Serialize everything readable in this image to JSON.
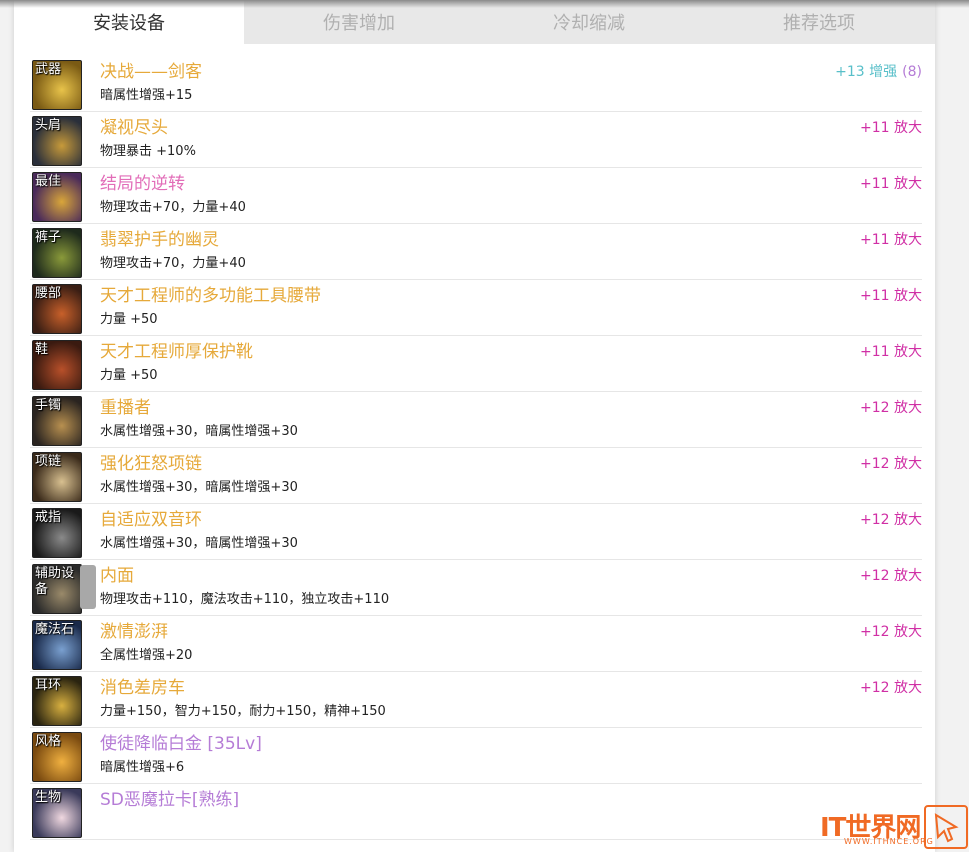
{
  "tabs": [
    {
      "label": "安装设备",
      "active": true
    },
    {
      "label": "伤害增加",
      "active": false
    },
    {
      "label": "冷却缩减",
      "active": false
    },
    {
      "label": "推荐选项",
      "active": false
    }
  ],
  "items": [
    {
      "slot": "武器",
      "name": "决战——剑客",
      "name_color": "gold",
      "stat": "暗属性增强+15",
      "upgrade": "+13 增强",
      "upgrade_count": "(8)",
      "upgrade_type": "enhance",
      "icon_colors": [
        "#7a5a14",
        "#e8c34a"
      ]
    },
    {
      "slot": "头肩",
      "name": "凝视尽头",
      "name_color": "gold",
      "stat": "物理暴击 +10%",
      "upgrade": "+11 放大",
      "upgrade_count": "",
      "upgrade_type": "amplify",
      "icon_colors": [
        "#2a2f3a",
        "#c79a3a"
      ]
    },
    {
      "slot": "最佳",
      "name": "结局的逆转",
      "name_color": "pink",
      "stat": "物理攻击+70，力量+40",
      "upgrade": "+11 放大",
      "upgrade_count": "",
      "upgrade_type": "amplify",
      "icon_colors": [
        "#4a2a5a",
        "#d9a63a"
      ]
    },
    {
      "slot": "裤子",
      "name": "翡翠护手的幽灵",
      "name_color": "gold",
      "stat": "物理攻击+70，力量+40",
      "upgrade": "+11 放大",
      "upgrade_count": "",
      "upgrade_type": "amplify",
      "icon_colors": [
        "#1e2a1c",
        "#8a9a3a"
      ]
    },
    {
      "slot": "腰部",
      "name": "天才工程师的多功能工具腰带",
      "name_color": "gold",
      "stat": "力量 +50",
      "upgrade": "+11 放大",
      "upgrade_count": "",
      "upgrade_type": "amplify",
      "icon_colors": [
        "#3a1e14",
        "#c8602a"
      ]
    },
    {
      "slot": "鞋",
      "name": "天才工程师厚保护靴",
      "name_color": "gold",
      "stat": "力量 +50",
      "upgrade": "+11 放大",
      "upgrade_count": "",
      "upgrade_type": "amplify",
      "icon_colors": [
        "#3a1a10",
        "#b8502a"
      ]
    },
    {
      "slot": "手镯",
      "name": "重播者",
      "name_color": "gold",
      "stat": "水属性增强+30，暗属性增强+30",
      "upgrade": "+12 放大",
      "upgrade_count": "",
      "upgrade_type": "amplify",
      "icon_colors": [
        "#2a2420",
        "#b89050"
      ]
    },
    {
      "slot": "项链",
      "name": "强化狂怒项链",
      "name_color": "gold",
      "stat": "水属性增强+30，暗属性增强+30",
      "upgrade": "+12 放大",
      "upgrade_count": "",
      "upgrade_type": "amplify",
      "icon_colors": [
        "#3a2a1a",
        "#d8c090"
      ]
    },
    {
      "slot": "戒指",
      "name": "自适应双音环",
      "name_color": "gold",
      "stat": "水属性增强+30，暗属性增强+30",
      "upgrade": "+12 放大",
      "upgrade_count": "",
      "upgrade_type": "amplify",
      "icon_colors": [
        "#1a1a1a",
        "#8a8a8a"
      ]
    },
    {
      "slot": "辅助设备",
      "name": "内面",
      "name_color": "gold",
      "stat": "物理攻击+110，魔法攻击+110，独立攻击+110",
      "upgrade": "+12 放大",
      "upgrade_count": "",
      "upgrade_type": "amplify",
      "icon_colors": [
        "#2a2a2a",
        "#9a8a6a"
      ]
    },
    {
      "slot": "魔法石",
      "name": "激情澎湃",
      "name_color": "gold",
      "stat": "全属性增强+20",
      "upgrade": "+12 放大",
      "upgrade_count": "",
      "upgrade_type": "amplify",
      "icon_colors": [
        "#1a2a4a",
        "#7aa0d0"
      ]
    },
    {
      "slot": "耳环",
      "name": "消色差房车",
      "name_color": "gold",
      "stat": "力量+150，智力+150，耐力+150，精神+150",
      "upgrade": "+12 放大",
      "upgrade_count": "",
      "upgrade_type": "amplify",
      "icon_colors": [
        "#2a2410",
        "#d8b040"
      ]
    },
    {
      "slot": "风格",
      "name": "使徒降临白金 [35Lv]",
      "name_color": "purple",
      "stat": "暗属性增强+6",
      "upgrade": "",
      "upgrade_count": "",
      "upgrade_type": "none",
      "icon_colors": [
        "#7a4a10",
        "#f0b040"
      ]
    },
    {
      "slot": "生物",
      "name": "SD恶魔拉卡[熟练]",
      "name_color": "purple",
      "stat": "",
      "upgrade": "",
      "upgrade_count": "",
      "upgrade_type": "none",
      "icon_colors": [
        "#3a3a5a",
        "#f0d8e0"
      ]
    }
  ],
  "watermark": {
    "title": "IT世界网",
    "sub": "WWW.ITHNCE.ORG"
  }
}
